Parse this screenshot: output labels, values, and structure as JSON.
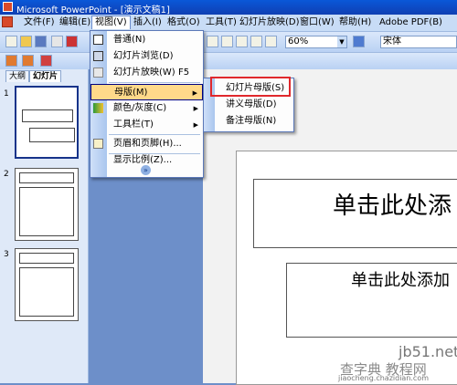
{
  "window": {
    "title": "Microsoft PowerPoint - [演示文稿1]"
  },
  "menubar": {
    "items": [
      {
        "label": "文件(F)"
      },
      {
        "label": "编辑(E)"
      },
      {
        "label": "视图(V)"
      },
      {
        "label": "插入(I)"
      },
      {
        "label": "格式(O)"
      },
      {
        "label": "工具(T)"
      },
      {
        "label": "幻灯片放映(D)"
      },
      {
        "label": "窗口(W)"
      },
      {
        "label": "帮助(H)"
      },
      {
        "label": "Adobe PDF(B)"
      }
    ]
  },
  "toolbar": {
    "zoom": "60%",
    "font": "宋体"
  },
  "left_pane": {
    "tabs": [
      {
        "label": "大纲"
      },
      {
        "label": "幻灯片"
      }
    ],
    "slide_numbers": [
      "1",
      "2",
      "3"
    ]
  },
  "view_menu": {
    "items": [
      {
        "label": "普通(N)",
        "shortcut": ""
      },
      {
        "label": "幻灯片浏览(D)",
        "shortcut": ""
      },
      {
        "label": "幻灯片放映(W)",
        "shortcut": "F5"
      },
      {
        "label": "母版(M)",
        "shortcut": ""
      },
      {
        "label": "颜色/灰度(C)",
        "shortcut": ""
      },
      {
        "label": "工具栏(T)",
        "shortcut": ""
      },
      {
        "label": "页眉和页脚(H)...",
        "shortcut": ""
      },
      {
        "label": "显示比例(Z)...",
        "shortcut": ""
      }
    ],
    "expand_glyph": "»"
  },
  "master_submenu": {
    "items": [
      {
        "label": "幻灯片母版(S)"
      },
      {
        "label": "讲义母版(D)"
      },
      {
        "label": "备注母版(N)"
      }
    ]
  },
  "slide": {
    "title_placeholder": "单击此处添",
    "subtitle_placeholder": "单击此处添加"
  },
  "watermark": {
    "site": "jb51.net",
    "brand": "查字典 教程网",
    "url": "jiaocheng.chazidian.com"
  },
  "colors": {
    "highlight": "#ffd98a",
    "callout": "#e0282c",
    "titlebar": "#0a58d8"
  }
}
